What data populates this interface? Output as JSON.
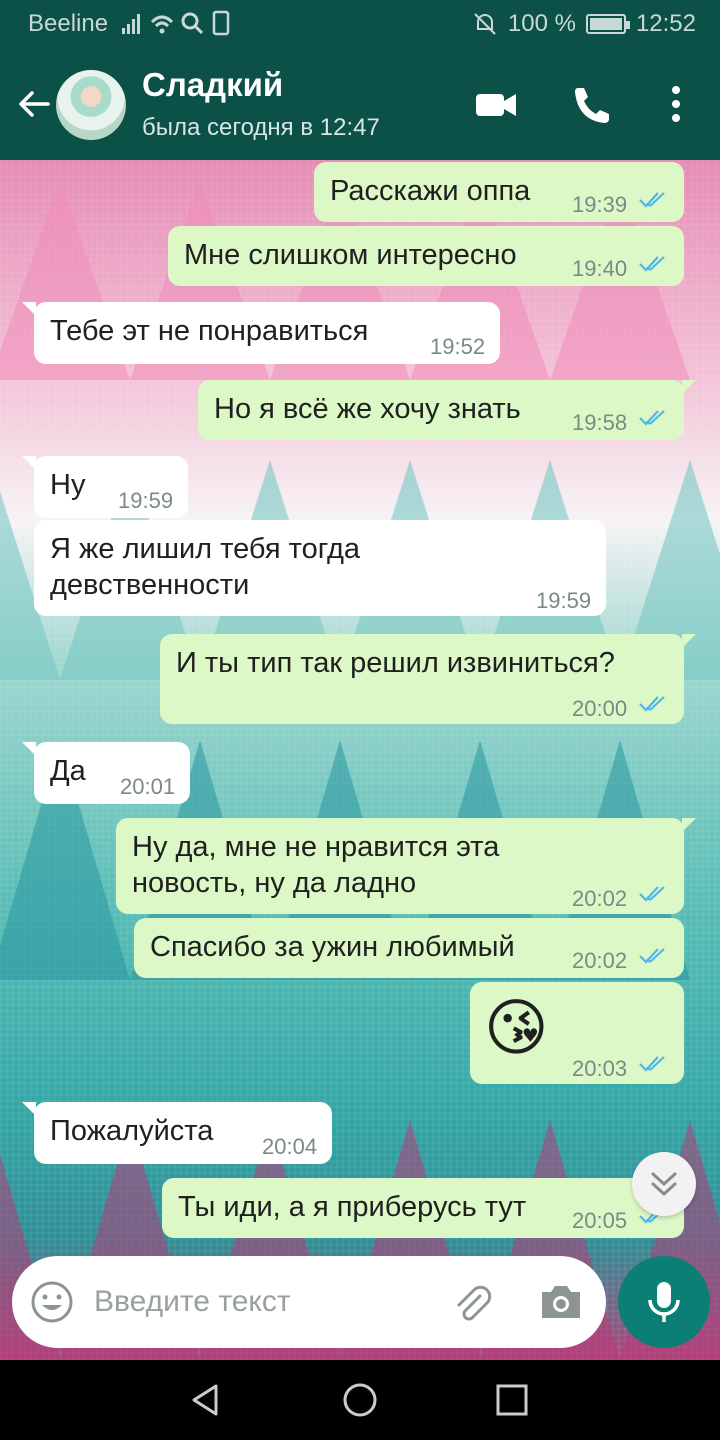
{
  "status_bar": {
    "carrier": "Beeline",
    "battery_text": "100 %",
    "time": "12:52"
  },
  "header": {
    "contact_name": "Сладкий",
    "last_seen": "была сегодня в 12:47"
  },
  "messages": [
    {
      "dir": "out",
      "text": "Расскажи оппа",
      "time": "19:39"
    },
    {
      "dir": "out",
      "text": "Мне слишком интересно",
      "time": "19:40"
    },
    {
      "dir": "in",
      "text": "Тебе эт не понравиться",
      "time": "19:52"
    },
    {
      "dir": "out",
      "text": "Но я всё же хочу знать",
      "time": "19:58"
    },
    {
      "dir": "in",
      "text": "Ну",
      "time": "19:59"
    },
    {
      "dir": "in",
      "text_line1": "Я же лишил тебя тогда",
      "text_line2": "девственности",
      "time": "19:59"
    },
    {
      "dir": "out",
      "text": "И ты тип так решил извиниться?",
      "time": "20:00"
    },
    {
      "dir": "in",
      "text": "Да",
      "time": "20:01"
    },
    {
      "dir": "out",
      "text_line1": "Ну да, мне не нравится эта",
      "text_line2": "новость, ну да ладно",
      "time": "20:02"
    },
    {
      "dir": "out",
      "text": "Спасибо за ужин любимый",
      "time": "20:02"
    },
    {
      "dir": "out",
      "emoji": "😘",
      "time": "20:03"
    },
    {
      "dir": "in",
      "text": "Пожалуйста",
      "time": "20:04"
    },
    {
      "dir": "out",
      "text": "Ты иди, а я приберусь тут",
      "time": "20:05"
    }
  ],
  "input": {
    "placeholder": "Введите текст"
  },
  "colors": {
    "header_bg": "#0b5148",
    "outgoing_bubble": "#dcf8c6",
    "incoming_bubble": "#ffffff",
    "read_ticks": "#4fb6ec",
    "mic_button": "#0b7f73"
  }
}
